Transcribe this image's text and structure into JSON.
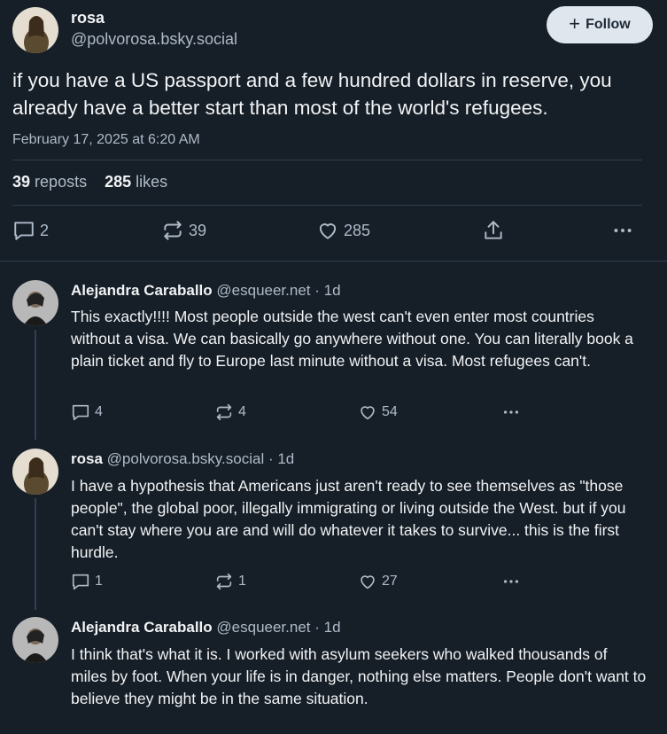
{
  "main_post": {
    "author_name": "rosa",
    "author_handle": "@polvorosa.bsky.social",
    "follow_label": "Follow",
    "text": "if you have a US passport and a few hundred dollars in reserve, you already have a better start than most of the world's refugees.",
    "timestamp": "February 17, 2025 at 6:20 AM",
    "reposts_count": "39",
    "reposts_label": "reposts",
    "likes_count": "285",
    "likes_label": "likes",
    "actions": {
      "replies": "2",
      "reposts": "39",
      "likes": "285"
    }
  },
  "replies": [
    {
      "author_name": "Alejandra Caraballo",
      "author_handle": "@esqueer.net",
      "age": "· 1d",
      "text": "This exactly!!!! Most people outside the west can't even enter most countries without a visa. We can basically go anywhere without one. You can literally book a plain ticket and fly to Europe last minute without a visa. Most refugees can't.",
      "replies": "4",
      "reposts": "4",
      "likes": "54"
    },
    {
      "author_name": "rosa",
      "author_handle": "@polvorosa.bsky.social",
      "age": "· 1d",
      "text": "I have a hypothesis that Americans just aren't ready to see themselves as \"those people\", the global poor, illegally immigrating or living outside the West. but if you can't stay where you are and will do whatever it takes to survive... this is the first hurdle.",
      "replies": "1",
      "reposts": "1",
      "likes": "27"
    },
    {
      "author_name": "Alejandra Caraballo",
      "author_handle": "@esqueer.net",
      "age": "· 1d",
      "text": "I think that's what it is. I worked with asylum seekers who walked thousands of miles by foot. When your life is in danger, nothing else matters. People don't want to believe they might be in the same situation."
    }
  ],
  "icons": [
    "reply-icon",
    "repost-icon",
    "like-icon",
    "share-icon",
    "more-icon",
    "plus-icon"
  ],
  "colors": {
    "background": "#161e27",
    "text": "#f1f3f5",
    "muted": "#aebbc9",
    "divider": "#2e4052",
    "follow_bg": "#dfe6ed"
  }
}
